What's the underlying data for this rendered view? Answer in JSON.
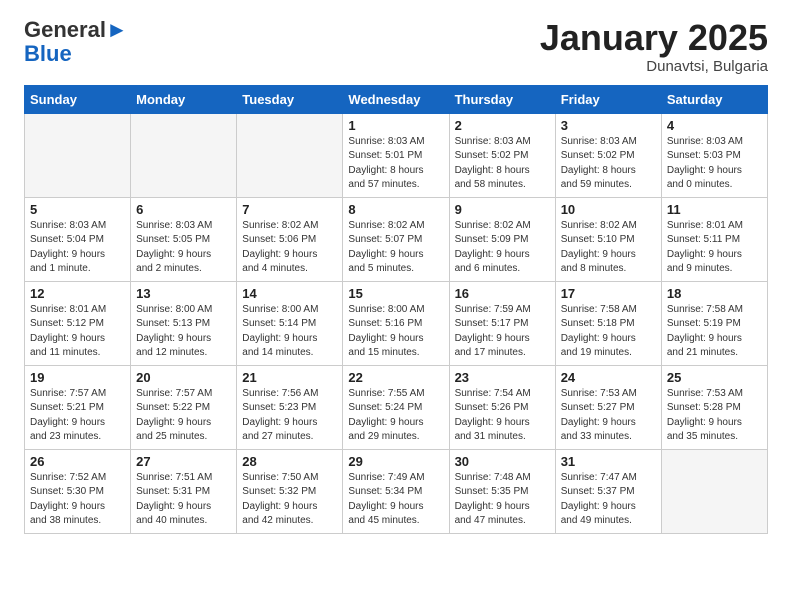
{
  "header": {
    "logo_general": "General",
    "logo_blue": "Blue",
    "month_title": "January 2025",
    "subtitle": "Dunavtsi, Bulgaria"
  },
  "weekdays": [
    "Sunday",
    "Monday",
    "Tuesday",
    "Wednesday",
    "Thursday",
    "Friday",
    "Saturday"
  ],
  "weeks": [
    [
      {
        "day": "",
        "info": ""
      },
      {
        "day": "",
        "info": ""
      },
      {
        "day": "",
        "info": ""
      },
      {
        "day": "1",
        "info": "Sunrise: 8:03 AM\nSunset: 5:01 PM\nDaylight: 8 hours\nand 57 minutes."
      },
      {
        "day": "2",
        "info": "Sunrise: 8:03 AM\nSunset: 5:02 PM\nDaylight: 8 hours\nand 58 minutes."
      },
      {
        "day": "3",
        "info": "Sunrise: 8:03 AM\nSunset: 5:02 PM\nDaylight: 8 hours\nand 59 minutes."
      },
      {
        "day": "4",
        "info": "Sunrise: 8:03 AM\nSunset: 5:03 PM\nDaylight: 9 hours\nand 0 minutes."
      }
    ],
    [
      {
        "day": "5",
        "info": "Sunrise: 8:03 AM\nSunset: 5:04 PM\nDaylight: 9 hours\nand 1 minute."
      },
      {
        "day": "6",
        "info": "Sunrise: 8:03 AM\nSunset: 5:05 PM\nDaylight: 9 hours\nand 2 minutes."
      },
      {
        "day": "7",
        "info": "Sunrise: 8:02 AM\nSunset: 5:06 PM\nDaylight: 9 hours\nand 4 minutes."
      },
      {
        "day": "8",
        "info": "Sunrise: 8:02 AM\nSunset: 5:07 PM\nDaylight: 9 hours\nand 5 minutes."
      },
      {
        "day": "9",
        "info": "Sunrise: 8:02 AM\nSunset: 5:09 PM\nDaylight: 9 hours\nand 6 minutes."
      },
      {
        "day": "10",
        "info": "Sunrise: 8:02 AM\nSunset: 5:10 PM\nDaylight: 9 hours\nand 8 minutes."
      },
      {
        "day": "11",
        "info": "Sunrise: 8:01 AM\nSunset: 5:11 PM\nDaylight: 9 hours\nand 9 minutes."
      }
    ],
    [
      {
        "day": "12",
        "info": "Sunrise: 8:01 AM\nSunset: 5:12 PM\nDaylight: 9 hours\nand 11 minutes."
      },
      {
        "day": "13",
        "info": "Sunrise: 8:00 AM\nSunset: 5:13 PM\nDaylight: 9 hours\nand 12 minutes."
      },
      {
        "day": "14",
        "info": "Sunrise: 8:00 AM\nSunset: 5:14 PM\nDaylight: 9 hours\nand 14 minutes."
      },
      {
        "day": "15",
        "info": "Sunrise: 8:00 AM\nSunset: 5:16 PM\nDaylight: 9 hours\nand 15 minutes."
      },
      {
        "day": "16",
        "info": "Sunrise: 7:59 AM\nSunset: 5:17 PM\nDaylight: 9 hours\nand 17 minutes."
      },
      {
        "day": "17",
        "info": "Sunrise: 7:58 AM\nSunset: 5:18 PM\nDaylight: 9 hours\nand 19 minutes."
      },
      {
        "day": "18",
        "info": "Sunrise: 7:58 AM\nSunset: 5:19 PM\nDaylight: 9 hours\nand 21 minutes."
      }
    ],
    [
      {
        "day": "19",
        "info": "Sunrise: 7:57 AM\nSunset: 5:21 PM\nDaylight: 9 hours\nand 23 minutes."
      },
      {
        "day": "20",
        "info": "Sunrise: 7:57 AM\nSunset: 5:22 PM\nDaylight: 9 hours\nand 25 minutes."
      },
      {
        "day": "21",
        "info": "Sunrise: 7:56 AM\nSunset: 5:23 PM\nDaylight: 9 hours\nand 27 minutes."
      },
      {
        "day": "22",
        "info": "Sunrise: 7:55 AM\nSunset: 5:24 PM\nDaylight: 9 hours\nand 29 minutes."
      },
      {
        "day": "23",
        "info": "Sunrise: 7:54 AM\nSunset: 5:26 PM\nDaylight: 9 hours\nand 31 minutes."
      },
      {
        "day": "24",
        "info": "Sunrise: 7:53 AM\nSunset: 5:27 PM\nDaylight: 9 hours\nand 33 minutes."
      },
      {
        "day": "25",
        "info": "Sunrise: 7:53 AM\nSunset: 5:28 PM\nDaylight: 9 hours\nand 35 minutes."
      }
    ],
    [
      {
        "day": "26",
        "info": "Sunrise: 7:52 AM\nSunset: 5:30 PM\nDaylight: 9 hours\nand 38 minutes."
      },
      {
        "day": "27",
        "info": "Sunrise: 7:51 AM\nSunset: 5:31 PM\nDaylight: 9 hours\nand 40 minutes."
      },
      {
        "day": "28",
        "info": "Sunrise: 7:50 AM\nSunset: 5:32 PM\nDaylight: 9 hours\nand 42 minutes."
      },
      {
        "day": "29",
        "info": "Sunrise: 7:49 AM\nSunset: 5:34 PM\nDaylight: 9 hours\nand 45 minutes."
      },
      {
        "day": "30",
        "info": "Sunrise: 7:48 AM\nSunset: 5:35 PM\nDaylight: 9 hours\nand 47 minutes."
      },
      {
        "day": "31",
        "info": "Sunrise: 7:47 AM\nSunset: 5:37 PM\nDaylight: 9 hours\nand 49 minutes."
      },
      {
        "day": "",
        "info": ""
      }
    ]
  ]
}
